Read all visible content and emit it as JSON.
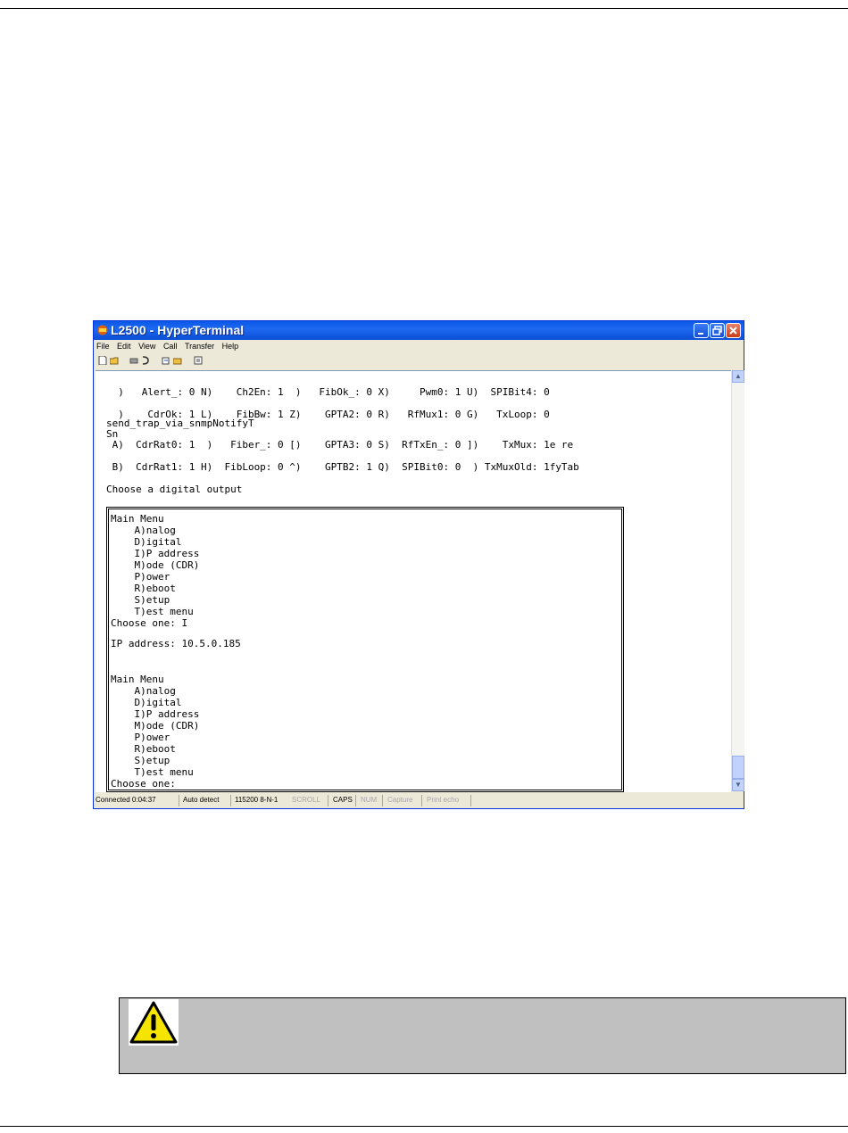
{
  "window": {
    "title": "L2500 - HyperTerminal",
    "menu": [
      "File",
      "Edit",
      "View",
      "Call",
      "Transfer",
      "Help"
    ]
  },
  "terminal": {
    "status_rows": [
      "  )   Alert_: 0 N)    Ch2En: 1  )   FibOk_: 0 X)     Pwm0: 1 U)  SPIBit4: 0",
      "  )    CdrOk: 1 L)    FibBw: 1 Z)    GPTA2: 0 R)   RfMux1: 0 G)   TxLoop: 0",
      "send_trap_via_snmpNotifyT",
      "Sn",
      " A)  CdrRat0: 1  )   Fiber_: 0 [)    GPTA3: 0 S)  RfTxEn_: 0 ])    TxMux: 1e re",
      " B)  CdrRat1: 1 H)  FibLoop: 0 ^)    GPTB2: 1 Q)  SPIBit0: 0  ) TxMuxOld: 1fyTab"
    ],
    "prompt": "Choose a digital output",
    "menu_block_1": [
      "Main Menu",
      "    A)nalog",
      "    D)igital",
      "    I)P address",
      "    M)ode (CDR)",
      "    P)ower",
      "    R)eboot",
      "    S)etup",
      "    T)est menu",
      "Choose one: I"
    ],
    "ip_line": "IP address: 10.5.0.185",
    "menu_block_2": [
      "Main Menu",
      "    A)nalog",
      "    D)igital",
      "    I)P address",
      "    M)ode (CDR)",
      "    P)ower",
      "    R)eboot",
      "    S)etup",
      "    T)est menu",
      "Choose one:"
    ]
  },
  "statusbar": {
    "connected": "Connected 0:04:37",
    "detect": "Auto detect",
    "settings": "115200 8-N-1",
    "scroll": "SCROLL",
    "caps": "CAPS",
    "num": "NUM",
    "capture": "Capture",
    "print_echo": "Print echo"
  },
  "icons": [
    "new-icon",
    "open-icon",
    "disconnect-icon",
    "dial-icon",
    "send-icon",
    "receive-icon",
    "properties-icon",
    "warning-icon"
  ],
  "colors": {
    "titlebar": "#0a58e8",
    "warning_bg": "#c0c0c0",
    "warning_icon": "#f5e400"
  }
}
